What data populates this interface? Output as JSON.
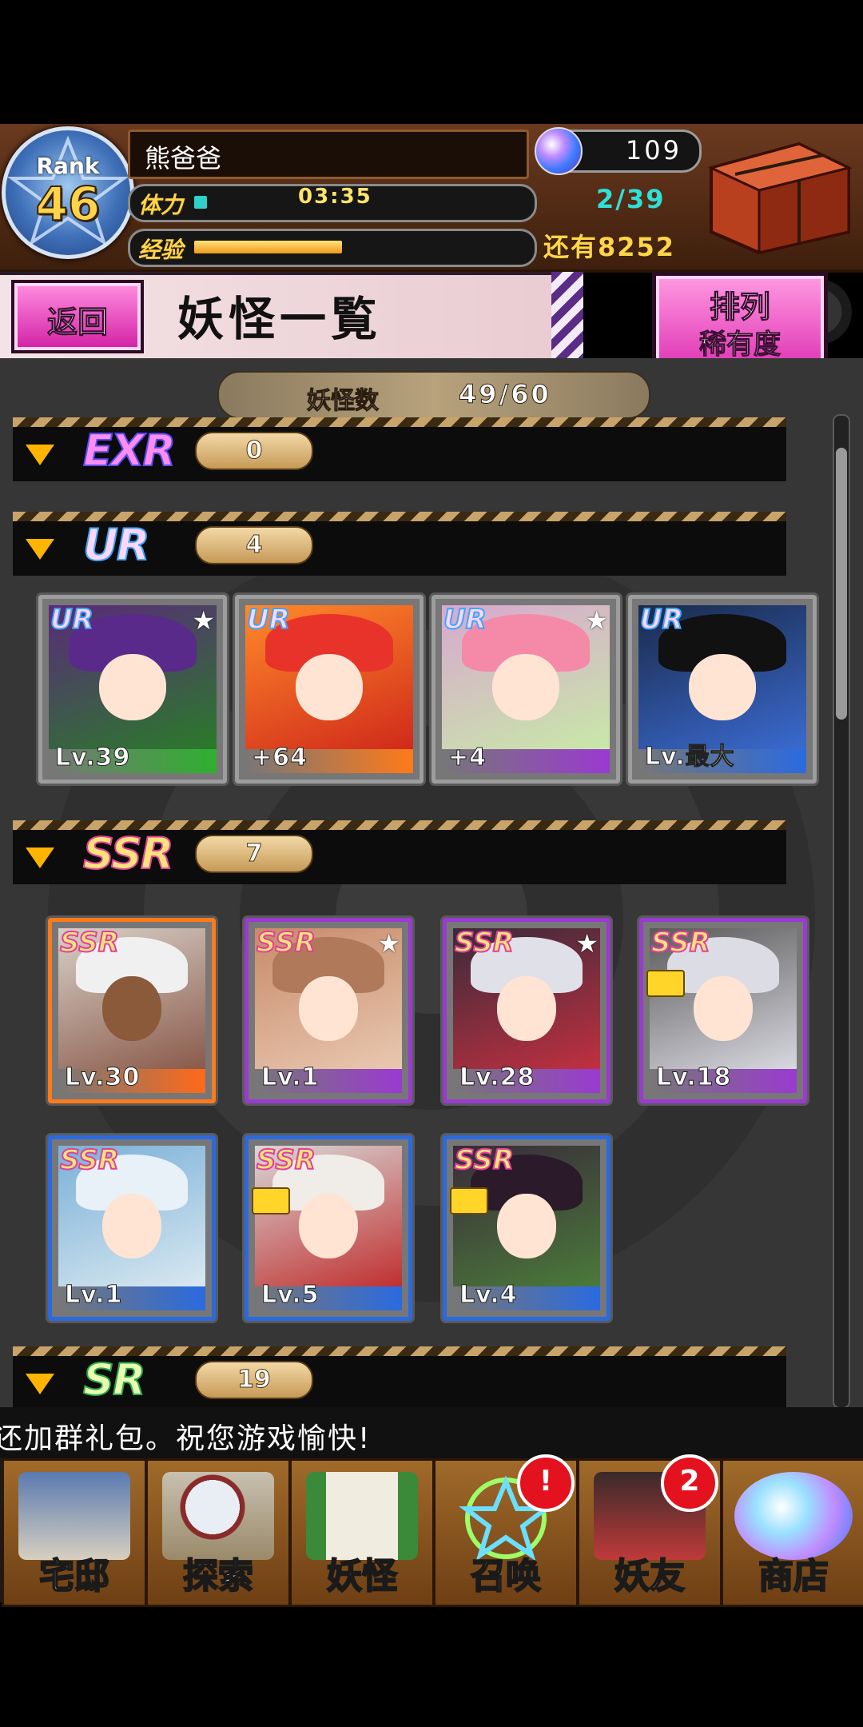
{
  "header": {
    "rank_label": "Rank",
    "rank_value": "46",
    "player_name": "熊爸爸",
    "stamina_label": "体力",
    "stamina_time": "03:35",
    "stamina_count": "2/39",
    "exp_label": "经验",
    "exp_remaining": "还有8252",
    "gem_count": "109",
    "stamina_fill_fraction": 0.04,
    "exp_fill_fraction": 0.45
  },
  "title_bar": {
    "back_label": "返回",
    "title": "妖怪一覧",
    "sort_label": "排列",
    "sort_value": "稀有度"
  },
  "count": {
    "label": "妖怪数",
    "value": "49/60"
  },
  "sections": [
    {
      "rarity": "EXR",
      "count": "0"
    },
    {
      "rarity": "UR",
      "count": "4"
    },
    {
      "rarity": "SSR",
      "count": "7"
    },
    {
      "rarity": "SR",
      "count": "19"
    }
  ],
  "ur_cards": [
    {
      "rarity": "UR",
      "level": "Lv.39",
      "star": "★"
    },
    {
      "rarity": "UR",
      "level": "+64",
      "star": ""
    },
    {
      "rarity": "UR",
      "level": "+4",
      "star": "★"
    },
    {
      "rarity": "UR",
      "level": "Lv.最大",
      "star": ""
    }
  ],
  "ssr_cards": [
    {
      "rarity": "SSR",
      "level": "Lv.30",
      "star": ""
    },
    {
      "rarity": "SSR",
      "level": "Lv.1",
      "star": "★"
    },
    {
      "rarity": "SSR",
      "level": "Lv.28",
      "star": "★"
    },
    {
      "rarity": "SSR",
      "level": "Lv.18",
      "star": ""
    },
    {
      "rarity": "SSR",
      "level": "Lv.1",
      "star": ""
    },
    {
      "rarity": "SSR",
      "level": "Lv.5",
      "star": ""
    },
    {
      "rarity": "SSR",
      "level": "Lv.4",
      "star": ""
    }
  ],
  "ticker": "还加群礼包。祝您游戏愉快!",
  "nav": [
    {
      "label": "宅邸",
      "badge": ""
    },
    {
      "label": "探索",
      "badge": ""
    },
    {
      "label": "妖怪",
      "badge": ""
    },
    {
      "label": "召唤",
      "badge": "!"
    },
    {
      "label": "妖友",
      "badge": "2"
    },
    {
      "label": "商店",
      "badge": ""
    }
  ]
}
